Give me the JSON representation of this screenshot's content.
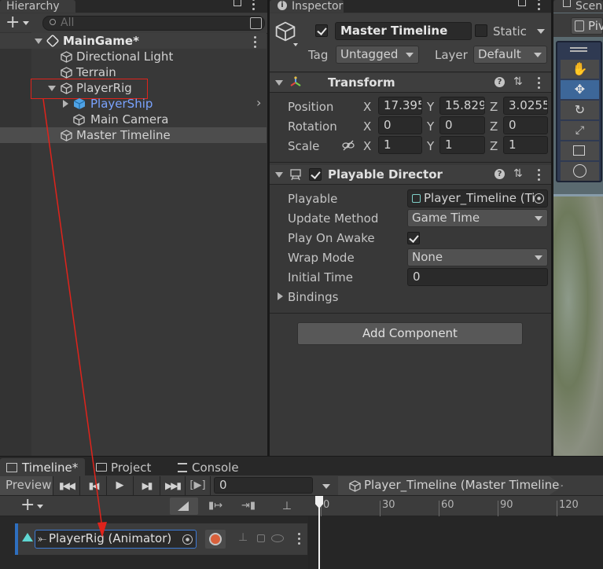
{
  "hierarchy": {
    "tab_label": "Hierarchy",
    "search_placeholder": "All",
    "scene_name": "MainGame*",
    "items": [
      {
        "label": "Directional Light"
      },
      {
        "label": "Terrain"
      },
      {
        "label": "PlayerRig"
      },
      {
        "label": "PlayerShip"
      },
      {
        "label": "Main Camera"
      },
      {
        "label": "Master Timeline"
      }
    ]
  },
  "inspector": {
    "tab_label": "Inspector",
    "object_name": "Master Timeline",
    "static_label": "Static",
    "tag_label": "Tag",
    "tag_value": "Untagged",
    "layer_label": "Layer",
    "layer_value": "Default",
    "transform": {
      "title": "Transform",
      "position_label": "Position",
      "rotation_label": "Rotation",
      "scale_label": "Scale",
      "position": {
        "x": "17.395",
        "y": "15.829",
        "z": "3.0255"
      },
      "rotation": {
        "x": "0",
        "y": "0",
        "z": "0"
      },
      "scale": {
        "x": "1",
        "y": "1",
        "z": "1"
      },
      "axis_x": "X",
      "axis_y": "Y",
      "axis_z": "Z"
    },
    "director": {
      "title": "Playable Director",
      "playable_label": "Playable",
      "playable_value": "Player_Timeline (Ti",
      "update_label": "Update Method",
      "update_value": "Game Time",
      "awake_label": "Play On Awake",
      "wrap_label": "Wrap Mode",
      "wrap_value": "None",
      "initial_label": "Initial Time",
      "initial_value": "0",
      "bindings_label": "Bindings"
    },
    "add_component": "Add Component"
  },
  "scene": {
    "tab_label": "Scen",
    "pivot_label": "Piv"
  },
  "bottom_tabs": {
    "timeline": "Timeline*",
    "project": "Project",
    "console": "Console"
  },
  "timeline": {
    "preview_label": "Preview",
    "frame_value": "0",
    "asset_label": "Player_Timeline (Master Timeline)",
    "ruler_ticks": [
      "0",
      "30",
      "60",
      "90",
      "120"
    ],
    "track_label": "PlayerRig (Animator)"
  },
  "colors": {
    "accent_red": "#e0231b",
    "selection_blue": "#7aa3ff",
    "record_orange": "#d9603b"
  }
}
